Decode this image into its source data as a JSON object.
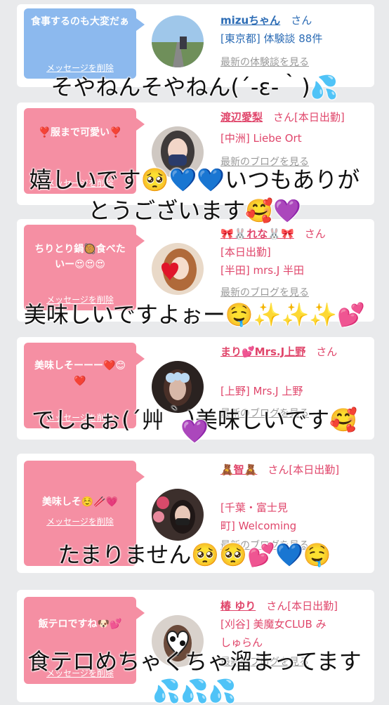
{
  "messages": [
    {
      "bubble": "食事するのも大変だぁ",
      "delete_label": "メッセージを削除",
      "name": "mizuちゃん",
      "san": "さん",
      "lines": [
        "[東京都] 体験談 88件"
      ],
      "latest": "最新の体験談を見る",
      "caption": "そやねんそやねん(´-ε-｀)💦"
    },
    {
      "bubble": "❣️服まで可愛い❣️",
      "delete_label": "メッセージを削除",
      "name": "渡辺愛梨",
      "san": "さん[本日出勤]",
      "lines": [
        "[中洲] Liebe Ort"
      ],
      "latest": "最新のブログを見る",
      "caption": "嬉しいです🥺💙💙いつもありが",
      "caption_b": "とうございます🥰💜"
    },
    {
      "bubble": "ちりとり鍋🥘食べたいー😍😍😍",
      "delete_label": "メッセージを削除",
      "name": "🎀🐰れな🐰🎀",
      "san": "さん",
      "lines": [
        "[本日出勤]",
        "[半田] mrs.J 半田"
      ],
      "latest": "最新のブログを見る",
      "caption": "美味しいですよぉー🤤✨✨✨💕"
    },
    {
      "bubble": "美味しそーーー❤️😊❤️",
      "delete_label": "メッセージを削除",
      "name": "まり💕Mrs.J上野",
      "san": "さん",
      "lines": [
        "[上野] Mrs.J 上野"
      ],
      "latest": "最新のブログを見る",
      "caption": "でしょぉ(´艸｀)美味しいです🥰",
      "caption_b": "💜"
    },
    {
      "bubble": "美味しそ☺️🥢💗",
      "delete_label": "メッセージを削除",
      "name": "🧸智🧸",
      "san": "さん[本日出勤]",
      "lines": [
        "[千葉・富士見",
        "町] Welcoming"
      ],
      "latest": "最新のブログを見る",
      "caption": "たまりません🥺🥺💕💙🤤"
    },
    {
      "bubble": "飯テロですね🐶💕",
      "delete_label": "メッセージを削除",
      "name": "椿 ゆり",
      "san": "さん[本日出勤]",
      "lines": [
        "[刈谷] 美魔女CLUB み",
        "しゅらん"
      ],
      "latest": "最新のブログを見る",
      "caption": "食テロめちゃくちゃ溜まってます",
      "caption_b": "💦💦💦"
    }
  ]
}
